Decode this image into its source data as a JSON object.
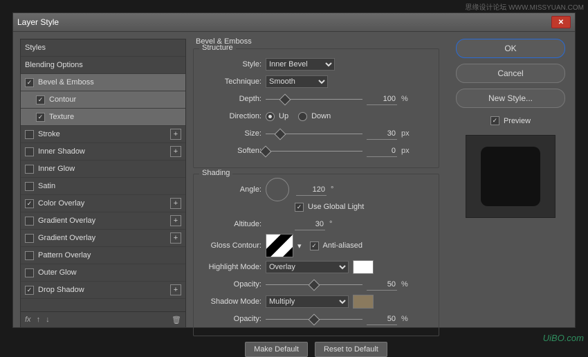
{
  "dialog": {
    "title": "Layer Style"
  },
  "sidebar": {
    "styles": "Styles",
    "blending": "Blending Options",
    "items": [
      {
        "label": "Bevel & Emboss",
        "checked": true,
        "selected": true
      },
      {
        "label": "Contour",
        "checked": true,
        "indent": true
      },
      {
        "label": "Texture",
        "checked": true,
        "indent": true
      },
      {
        "label": "Stroke",
        "checked": false,
        "add": true
      },
      {
        "label": "Inner Shadow",
        "checked": false,
        "add": true
      },
      {
        "label": "Inner Glow",
        "checked": false
      },
      {
        "label": "Satin",
        "checked": false
      },
      {
        "label": "Color Overlay",
        "checked": true,
        "add": true
      },
      {
        "label": "Gradient Overlay",
        "checked": false,
        "add": true
      },
      {
        "label": "Gradient Overlay",
        "checked": false,
        "add": true
      },
      {
        "label": "Pattern Overlay",
        "checked": false
      },
      {
        "label": "Outer Glow",
        "checked": false
      },
      {
        "label": "Drop Shadow",
        "checked": true,
        "add": true
      }
    ],
    "fx": "fx"
  },
  "panel": {
    "title": "Bevel & Emboss",
    "structure": {
      "group": "Structure",
      "style_label": "Style:",
      "style_value": "Inner Bevel",
      "technique_label": "Technique:",
      "technique_value": "Smooth",
      "depth_label": "Depth:",
      "depth_value": "100",
      "depth_unit": "%",
      "direction_label": "Direction:",
      "up": "Up",
      "down": "Down",
      "size_label": "Size:",
      "size_value": "30",
      "size_unit": "px",
      "soften_label": "Soften:",
      "soften_value": "0",
      "soften_unit": "px"
    },
    "shading": {
      "group": "Shading",
      "angle_label": "Angle:",
      "angle_value": "120",
      "deg": "°",
      "global": "Use Global Light",
      "altitude_label": "Altitude:",
      "altitude_value": "30",
      "gloss_label": "Gloss Contour:",
      "aa": "Anti-aliased",
      "hl_label": "Highlight Mode:",
      "hl_mode": "Overlay",
      "hl_color": "#ffffff",
      "opacity_label": "Opacity:",
      "hl_opacity": "50",
      "pct": "%",
      "sh_label": "Shadow Mode:",
      "sh_mode": "Multiply",
      "sh_color": "#8a7a5e",
      "sh_opacity": "50"
    },
    "buttons": {
      "make_default": "Make Default",
      "reset": "Reset to Default"
    }
  },
  "right": {
    "ok": "OK",
    "cancel": "Cancel",
    "new_style": "New Style...",
    "preview": "Preview"
  },
  "watermark": {
    "bottom": "UiBO.com",
    "top": "思缘设计论坛 WWW.MISSYUAN.COM"
  }
}
